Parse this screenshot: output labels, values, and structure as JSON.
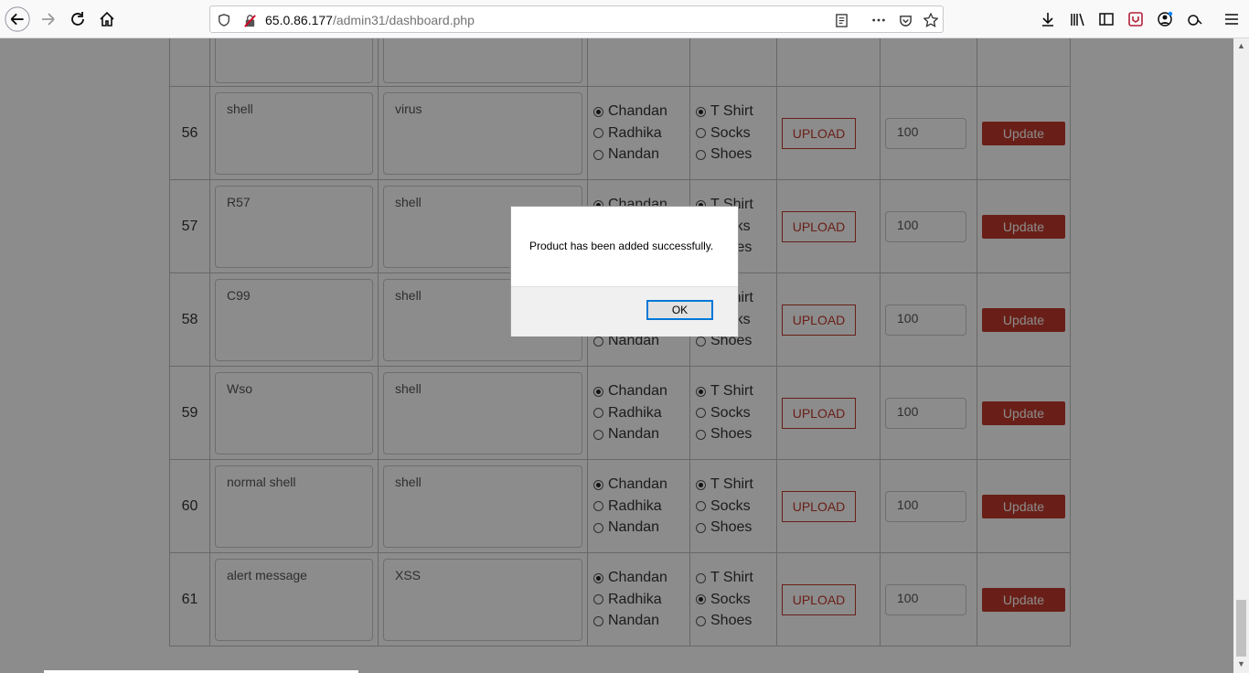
{
  "browser": {
    "url_host": "65.0.86.177",
    "url_path": "/admin31/dashboard.php"
  },
  "products": [
    {
      "id": "56",
      "name": "shell",
      "description": "virus",
      "owner_options": [
        "Chandan",
        "Radhika",
        "Nandan"
      ],
      "owner_selected": 0,
      "category_options": [
        "T Shirt",
        "Socks",
        "Shoes"
      ],
      "category_selected": 0,
      "upload_label": "UPLOAD",
      "quantity": "100",
      "update_label": "Update"
    },
    {
      "id": "57",
      "name": "R57",
      "description": "shell",
      "owner_options": [
        "Chandan",
        "Radhika",
        "Nandan"
      ],
      "owner_selected": 0,
      "category_options": [
        "T Shirt",
        "Socks",
        "Shoes"
      ],
      "category_selected": 0,
      "upload_label": "UPLOAD",
      "quantity": "100",
      "update_label": "Update"
    },
    {
      "id": "58",
      "name": "C99",
      "description": "shell",
      "owner_options": [
        "Chandan",
        "Radhika",
        "Nandan"
      ],
      "owner_selected": 0,
      "category_options": [
        "T Shirt",
        "Socks",
        "Shoes"
      ],
      "category_selected": 0,
      "upload_label": "UPLOAD",
      "quantity": "100",
      "update_label": "Update"
    },
    {
      "id": "59",
      "name": "Wso",
      "description": "shell",
      "owner_options": [
        "Chandan",
        "Radhika",
        "Nandan"
      ],
      "owner_selected": 0,
      "category_options": [
        "T Shirt",
        "Socks",
        "Shoes"
      ],
      "category_selected": 0,
      "upload_label": "UPLOAD",
      "quantity": "100",
      "update_label": "Update"
    },
    {
      "id": "60",
      "name": "normal shell",
      "description": "shell",
      "owner_options": [
        "Chandan",
        "Radhika",
        "Nandan"
      ],
      "owner_selected": 0,
      "category_options": [
        "T Shirt",
        "Socks",
        "Shoes"
      ],
      "category_selected": 0,
      "upload_label": "UPLOAD",
      "quantity": "100",
      "update_label": "Update"
    },
    {
      "id": "61",
      "name": "alert message",
      "description": "XSS",
      "owner_options": [
        "Chandan",
        "Radhika",
        "Nandan"
      ],
      "owner_selected": 0,
      "category_options": [
        "T Shirt",
        "Socks",
        "Shoes"
      ],
      "category_selected": 1,
      "upload_label": "UPLOAD",
      "quantity": "100",
      "update_label": "Update"
    }
  ],
  "dialog": {
    "message": "Product has been added successfully.",
    "ok_label": "OK"
  },
  "colors": {
    "accent": "#c0392b",
    "overlay": "rgba(0,0,0,0.45)"
  }
}
